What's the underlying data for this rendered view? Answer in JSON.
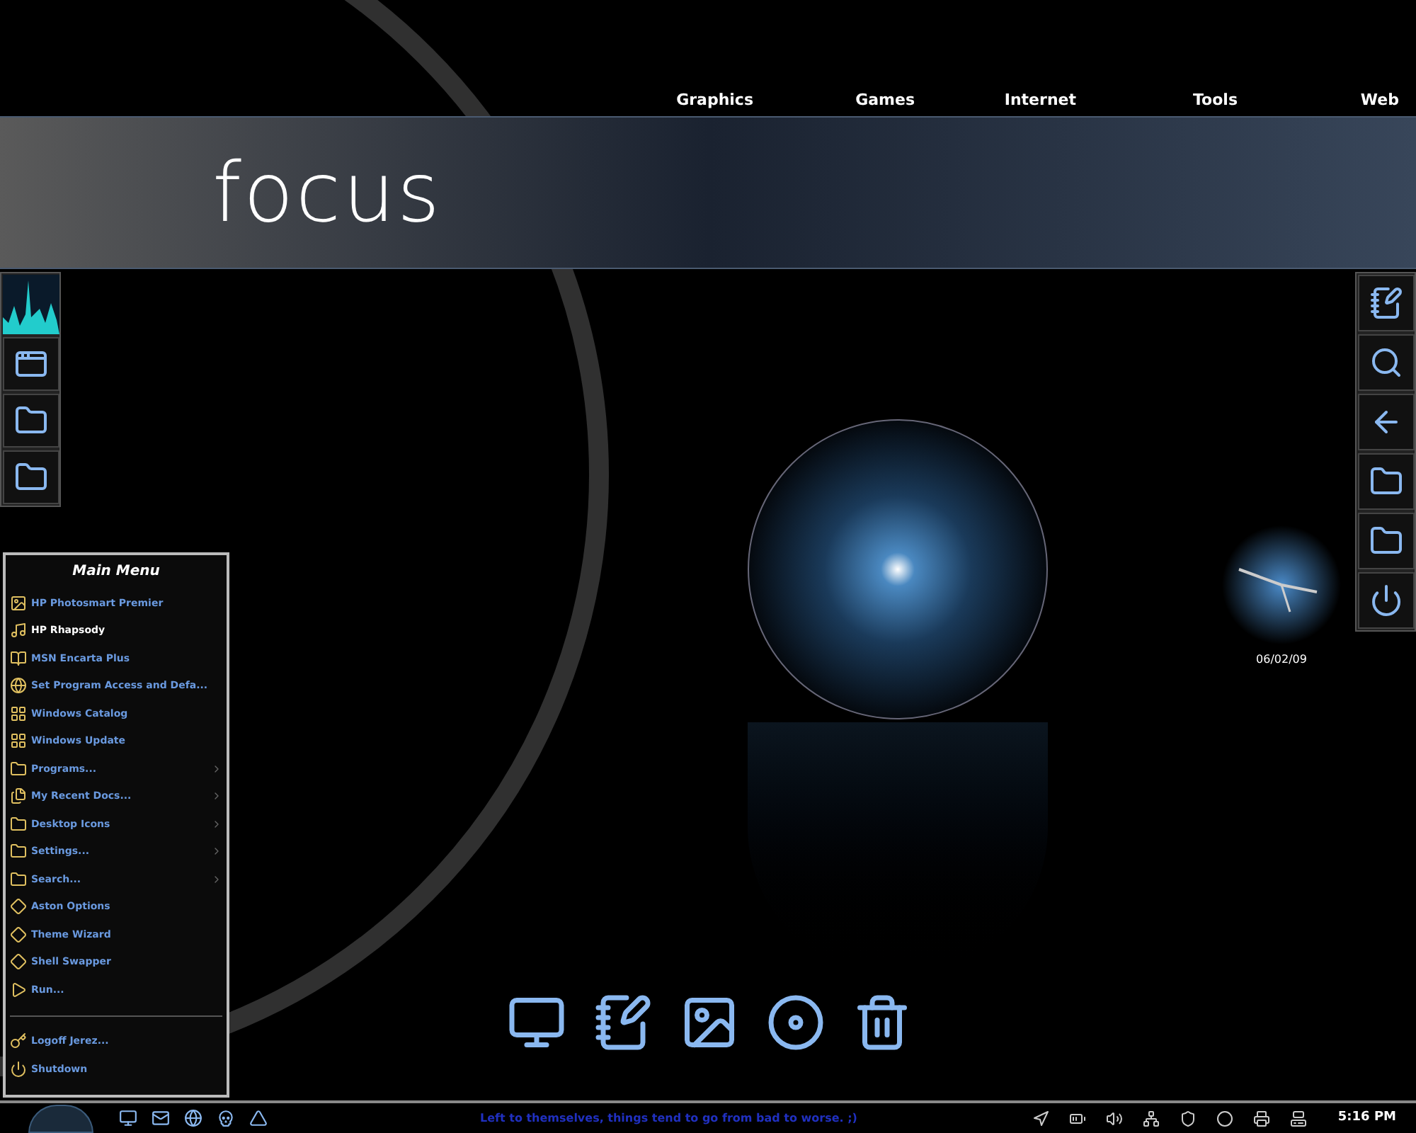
{
  "nav": [
    {
      "label": "Graphics"
    },
    {
      "label": "Games"
    },
    {
      "label": "Internet"
    },
    {
      "label": "Tools"
    },
    {
      "label": "Web"
    }
  ],
  "banner": {
    "title": "focus"
  },
  "main_menu": {
    "title": "Main Menu",
    "groups": [
      [
        {
          "label": "HP Photosmart Premier",
          "submenu": false,
          "selected": false
        },
        {
          "label": "HP Rhapsody",
          "submenu": false,
          "selected": true
        },
        {
          "label": "MSN Encarta Plus",
          "submenu": false,
          "selected": false
        },
        {
          "label": "Set Program Access and Defa...",
          "submenu": false,
          "selected": false
        },
        {
          "label": "Windows Catalog",
          "submenu": false,
          "selected": false
        },
        {
          "label": "Windows Update",
          "submenu": false,
          "selected": false
        },
        {
          "label": "Programs...",
          "submenu": true,
          "selected": false
        },
        {
          "label": "My Recent Docs...",
          "submenu": true,
          "selected": false
        },
        {
          "label": "Desktop Icons",
          "submenu": true,
          "selected": false
        },
        {
          "label": "Settings...",
          "submenu": true,
          "selected": false
        },
        {
          "label": "Search...",
          "submenu": true,
          "selected": false
        },
        {
          "label": "Aston Options",
          "submenu": false,
          "selected": false
        },
        {
          "label": "Theme Wizard",
          "submenu": false,
          "selected": false
        },
        {
          "label": "Shell Swapper",
          "submenu": false,
          "selected": false
        },
        {
          "label": "Run...",
          "submenu": false,
          "selected": false
        }
      ],
      [
        {
          "label": "Logoff Jerez...",
          "submenu": false,
          "selected": false
        },
        {
          "label": "Shutdown",
          "submenu": false,
          "selected": false
        }
      ]
    ]
  },
  "clock": {
    "date": "06/02/09"
  },
  "taskbar": {
    "quote": "Left to themselves, things tend to go from bad to worse. ;)",
    "time": "5:16 PM"
  }
}
